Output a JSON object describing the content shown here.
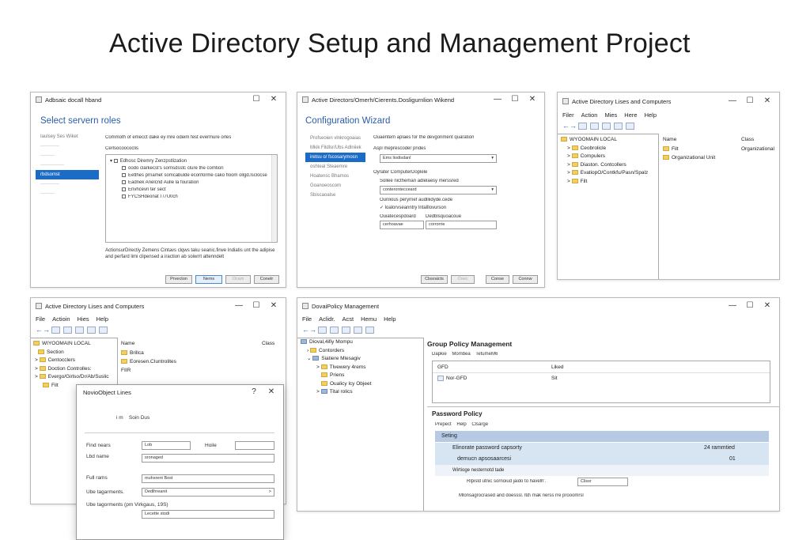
{
  "page_title": "Active Directory Setup and Management Project",
  "window_controls": {
    "minimize": "—",
    "maximize": "☐",
    "close": "✕",
    "help": "?"
  },
  "win1": {
    "title": "Adbsaic docall hband",
    "heading": "Select servern roles",
    "nav": [
      "Iaulsey Ses Wiket",
      "",
      "",
      "",
      "rbdsomst",
      "",
      ""
    ],
    "description": "Commoth of emecct dake ey mre odeim fest evermure orles",
    "section_label": "Cerlsocoococlis",
    "tree_parent": "Edhosc Diremry Zenzpstlization",
    "tree_items": [
      "oodo clarkecst's sornsdsstc clure the comtion",
      "Eetlhes prnamet somcabulde econforme cako floom ollgd.lsclocse",
      "Eadnek Anelcnd Aulle la fouration",
      "Envhcevn ter sect",
      "FYCSHdeonat I /7U0ch"
    ],
    "footer": "ActionsurDirectiy Zemens Cintavs clqws taku seanic.firwe Indiatis unt the adipise and perfard  limi clipensed a iraction ab soiwrrt attenndelt",
    "buttons": [
      "Prvecton",
      "Nems",
      "Ocam",
      "Conetr"
    ]
  },
  "win2": {
    "title": "Active Directors/Omerh/Cierents.Dosligurnlion Wikend",
    "heading": "Configuration Wizard",
    "nav": [
      "Profseoien vlnkrogoaias",
      "Mkik Fildlsr/Ubs Adlniiek",
      "iretsu o/ fscosarymosn",
      "oshteal Steaemre",
      "Hoatensc Bhamos",
      "Goanoeoscom",
      "Sbiscaoalse"
    ],
    "description": "Ouaentem aplaes for the devgonment quaration",
    "label1": "Aspl meprescoder prides",
    "select1": "Ems liodisdanl",
    "label2": "Oyrater ComputerDoplele",
    "label3": "Sollee nictheman adlelaesy merssred",
    "select2": "conterontecceard",
    "label4": "Ounlious peryrnef audlliidyde.cede",
    "checkbox": "loalorvseanntry lntalllovurson",
    "col1": "Ouiatecespdoard",
    "col2": "Dedblsquoacoue",
    "field1": "cerhoavae",
    "field2": "corrorrie",
    "buttons": [
      "Clssraicts",
      "Osec",
      "Conse",
      "Connw"
    ]
  },
  "win3": {
    "title": "Active Directory Lises and Computers",
    "menu": [
      "Filer",
      "Action",
      "Mies",
      "Here",
      "Help"
    ],
    "root": "WYOOMAIN LOCAL",
    "tree": [
      "Ceobrolicle",
      "Compulers",
      "Diaston. Contcollers",
      "EvatiopO/Contkfu/Pasn/Spalz",
      "Filt"
    ],
    "col_name": "Name",
    "col_class": "Class",
    "rows": [
      {
        "name": "Filt",
        "class": "Organizational"
      },
      {
        "name": "Organizational Unit",
        "class": ""
      }
    ]
  },
  "win4": {
    "title": "Active Directory Lises and Computers",
    "menu": [
      "File",
      "Actioin",
      "Hies",
      "Help"
    ],
    "root": "WIYOOMAIN LOCAL",
    "tree": [
      "Section",
      "Centocclers",
      "Doction Controlles:",
      "Evergo/Girlso/Dr/Ab/Suslic",
      "Filt"
    ],
    "col_name": "Name",
    "col_class": "Class",
    "rows": [
      "Brillca",
      "Eoresen.CIuntrolites",
      "FIIR"
    ]
  },
  "dialog": {
    "title": "NovioObject  Lines",
    "user_label": "Soin Dus",
    "user_prefix": "i m",
    "first_name_label": "Find nears",
    "first_name_value": "Lob",
    "initials_label": "Hoile",
    "initials_value": "",
    "last_name_label": "Lbd name",
    "last_name_value": "sronaged",
    "full_name_label": "Full rams",
    "full_name_value": "muhsrent Bost",
    "logon_label": "Ube tagarments.",
    "logon_value": "Dedlhreanit",
    "logon_label2": "Ube tagorments (pm Virkgaus, 19S)",
    "logon_value2": "Lecette stodi"
  },
  "win5": {
    "title": "DovaiPolicy Management",
    "menu": [
      "File",
      "Aclidr.",
      "Acst",
      "Hemu",
      "Help"
    ],
    "tree": [
      "Dioval,4ifiy Mompu",
      "Contorders",
      "Siatiere Mlesagiv",
      "Tlvewery 4rems",
      "Priens",
      "Oualicy lcy Objeet",
      "Tital rolics"
    ],
    "gpm_header": "Group Policy Management",
    "gpm_tabs": [
      "Dapkie",
      "Mombea",
      "TetumeM6"
    ],
    "gpm_col1": "GFD",
    "gpm_col2": "Liked",
    "gpm_row_name": "Nor-GFD",
    "gpm_row_value": "Sit",
    "pp_header": "Password Policy",
    "pp_tabs": [
      "Prepect",
      "Help",
      "Clsarge"
    ],
    "setting_header": "Seting",
    "row1_label": "Elinorate password capsorty",
    "row1_value": "24 rammtied",
    "row2_label": "demucn apsosaarcesi",
    "row2_value": "01",
    "row3_label": "Wirtioge nesternotd tade",
    "row4_label": "Rlpisld utnic sornoiud jaido to havelh'.",
    "row4_value": "Clissr",
    "row5_label": "Mlonsagrocrased and doesssl. ltd\\ mak nerss rre prooomrsl"
  }
}
